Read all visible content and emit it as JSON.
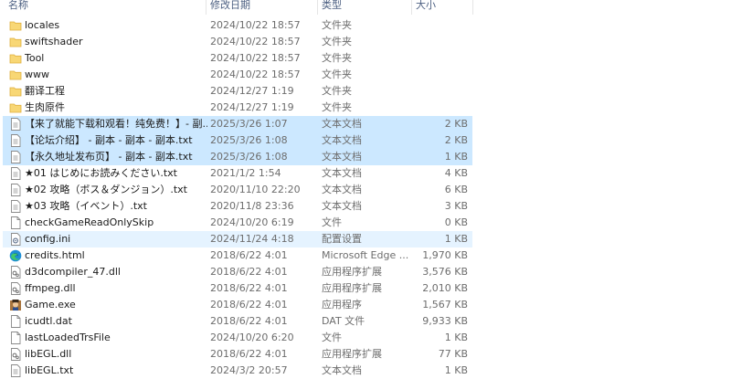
{
  "columns": {
    "name": "名称",
    "date": "修改日期",
    "type": "类型",
    "size": "大小"
  },
  "rows": [
    {
      "name": "locales",
      "date": "2024/10/22 18:57",
      "type": "文件夹",
      "size": "",
      "icon": "folder-icon",
      "state": ""
    },
    {
      "name": "swiftshader",
      "date": "2024/10/22 18:57",
      "type": "文件夹",
      "size": "",
      "icon": "folder-icon",
      "state": ""
    },
    {
      "name": "Tool",
      "date": "2024/10/22 18:57",
      "type": "文件夹",
      "size": "",
      "icon": "folder-icon",
      "state": ""
    },
    {
      "name": "www",
      "date": "2024/10/22 18:57",
      "type": "文件夹",
      "size": "",
      "icon": "folder-icon",
      "state": ""
    },
    {
      "name": "翻译工程",
      "date": "2024/12/27 1:19",
      "type": "文件夹",
      "size": "",
      "icon": "folder-icon",
      "state": ""
    },
    {
      "name": "生肉原件",
      "date": "2024/12/27 1:19",
      "type": "文件夹",
      "size": "",
      "icon": "folder-icon",
      "state": ""
    },
    {
      "name": "【来了就能下载和观看！纯免费！】- 副...",
      "date": "2025/3/26 1:07",
      "type": "文本文档",
      "size": "2 KB",
      "icon": "text-file-icon",
      "state": "sel"
    },
    {
      "name": "【论坛介绍】 - 副本 - 副本 - 副本.txt",
      "date": "2025/3/26 1:08",
      "type": "文本文档",
      "size": "2 KB",
      "icon": "text-file-icon",
      "state": "sel"
    },
    {
      "name": "【永久地址发布页】 - 副本 - 副本.txt",
      "date": "2025/3/26 1:08",
      "type": "文本文档",
      "size": "1 KB",
      "icon": "text-file-icon",
      "state": "sel"
    },
    {
      "name": "★01 はじめにお読みください.txt",
      "date": "2021/1/2 1:54",
      "type": "文本文档",
      "size": "4 KB",
      "icon": "text-file-icon",
      "state": ""
    },
    {
      "name": "★02 攻略（ボス＆ダンジョン）.txt",
      "date": "2020/11/10 22:20",
      "type": "文本文档",
      "size": "6 KB",
      "icon": "text-file-icon",
      "state": ""
    },
    {
      "name": "★03 攻略（イベント）.txt",
      "date": "2020/11/8 23:36",
      "type": "文本文档",
      "size": "3 KB",
      "icon": "text-file-icon",
      "state": ""
    },
    {
      "name": "checkGameReadOnlySkip",
      "date": "2024/10/20 6:19",
      "type": "文件",
      "size": "0 KB",
      "icon": "blank-file-icon",
      "state": ""
    },
    {
      "name": "config.ini",
      "date": "2024/11/24 4:18",
      "type": "配置设置",
      "size": "1 KB",
      "icon": "settings-file-icon",
      "state": "hov"
    },
    {
      "name": "credits.html",
      "date": "2018/6/22 4:01",
      "type": "Microsoft Edge ...",
      "size": "1,970 KB",
      "icon": "edge-icon",
      "state": ""
    },
    {
      "name": "d3dcompiler_47.dll",
      "date": "2018/6/22 4:01",
      "type": "应用程序扩展",
      "size": "3,576 KB",
      "icon": "dll-file-icon",
      "state": ""
    },
    {
      "name": "ffmpeg.dll",
      "date": "2018/6/22 4:01",
      "type": "应用程序扩展",
      "size": "2,010 KB",
      "icon": "dll-file-icon",
      "state": ""
    },
    {
      "name": "Game.exe",
      "date": "2018/6/22 4:01",
      "type": "应用程序",
      "size": "1,567 KB",
      "icon": "game-exe-icon",
      "state": ""
    },
    {
      "name": "icudtl.dat",
      "date": "2018/6/22 4:01",
      "type": "DAT 文件",
      "size": "9,933 KB",
      "icon": "blank-file-icon",
      "state": ""
    },
    {
      "name": "lastLoadedTrsFile",
      "date": "2024/10/20 6:20",
      "type": "文件",
      "size": "1 KB",
      "icon": "blank-file-icon",
      "state": ""
    },
    {
      "name": "libEGL.dll",
      "date": "2018/6/22 4:01",
      "type": "应用程序扩展",
      "size": "77 KB",
      "icon": "dll-file-icon",
      "state": ""
    },
    {
      "name": "libEGL.txt",
      "date": "2024/3/2 20:57",
      "type": "文本文档",
      "size": "1 KB",
      "icon": "text-file-icon",
      "state": ""
    }
  ]
}
